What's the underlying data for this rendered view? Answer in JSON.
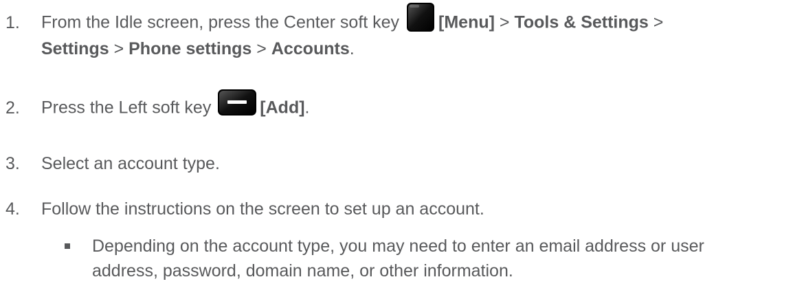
{
  "steps": [
    {
      "number": "1.",
      "line1_pre": "From the Idle screen, press the Center soft key ",
      "key1_label": "[Menu]",
      "sep1": " > ",
      "path1": "Tools & Settings",
      "sep2": " >",
      "path2": "Settings",
      "sep3": " > ",
      "path3": "Phone settings",
      "sep4": " > ",
      "path4": "Accounts",
      "end": ".",
      "key_icon": "center-soft-key-icon"
    },
    {
      "number": "2.",
      "text_pre": "Press the Left soft key ",
      "key_label": "[Add]",
      "end": ".",
      "key_icon": "left-soft-key-icon"
    },
    {
      "number": "3.",
      "text": "Select an account type."
    },
    {
      "number": "4.",
      "text": "Follow the instructions on the screen to set up an account."
    }
  ],
  "bullet": {
    "line1": "Depending on the account type, you may need to enter an email address or user",
    "line2": "address, password, domain name, or other information."
  },
  "colors": {
    "text": "#58595b",
    "key_dark": "#111111"
  }
}
